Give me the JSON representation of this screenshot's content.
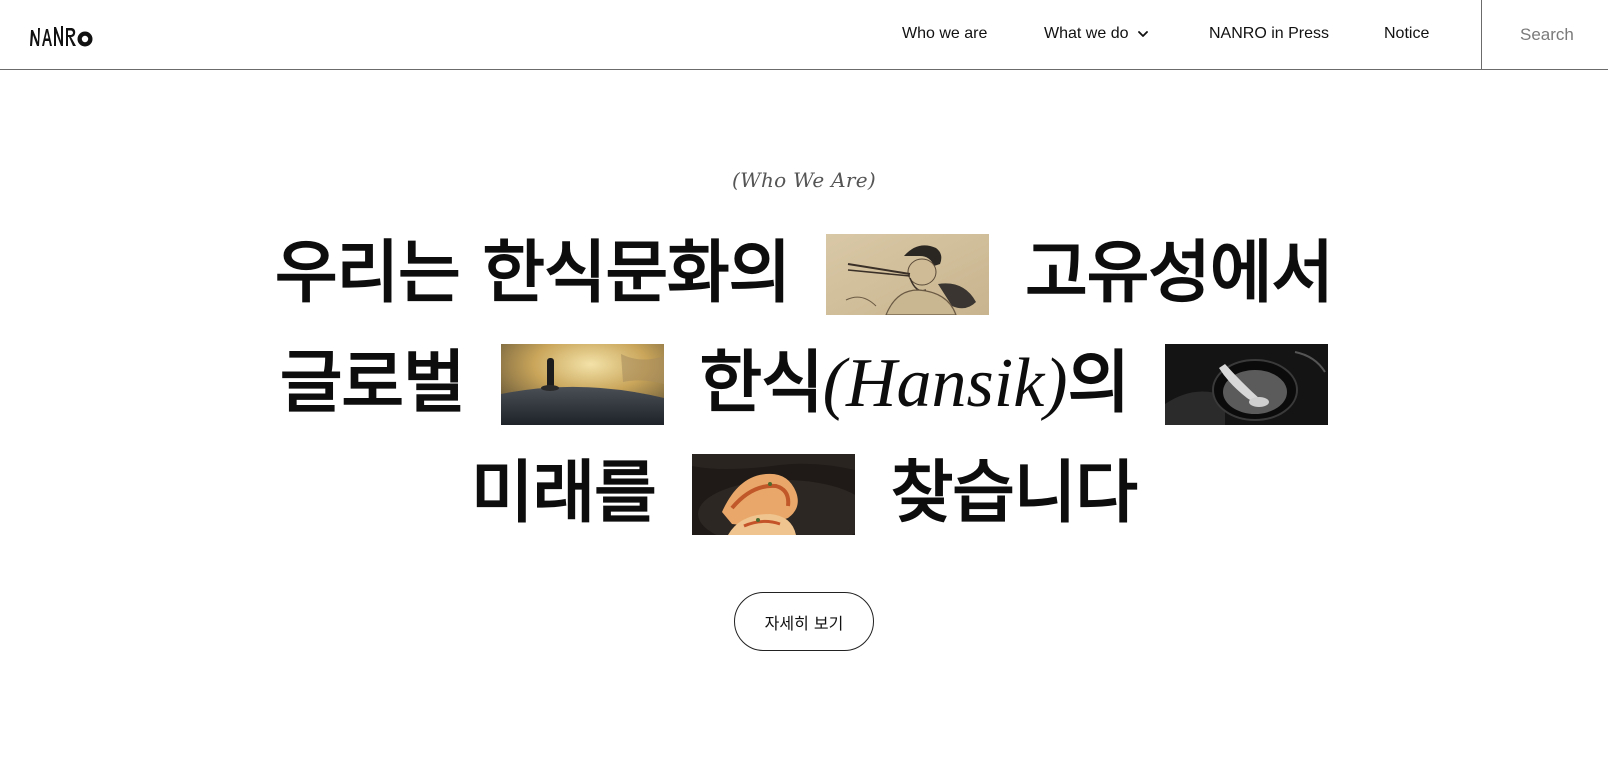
{
  "header": {
    "logo_text": "NANRO",
    "nav": {
      "who_we_are": "Who we are",
      "what_we_do": "What we do",
      "press": "NANRO in Press",
      "notice": "Notice"
    },
    "search": {
      "placeholder": "Search"
    }
  },
  "hero": {
    "eyebrow": "(Who We Are)",
    "line1": {
      "part1": "우리는 한식문화의",
      "part2": "고유성에서"
    },
    "line2": {
      "part1": "글로벌",
      "part2_korean": "한식",
      "part2_latin": "(Hansik)",
      "part2_suffix": "의"
    },
    "line3": {
      "part1": "미래를",
      "part2": "찾습니다"
    },
    "images": {
      "image1": "traditional-painting-scholar",
      "image2": "cast-iron-pot-lid",
      "image3": "black-ceramic-bowl",
      "image4": "kimchi-dish"
    },
    "cta_label": "자세히 보기"
  },
  "icons": {
    "nav_dropdown": "chevron-down-icon"
  }
}
